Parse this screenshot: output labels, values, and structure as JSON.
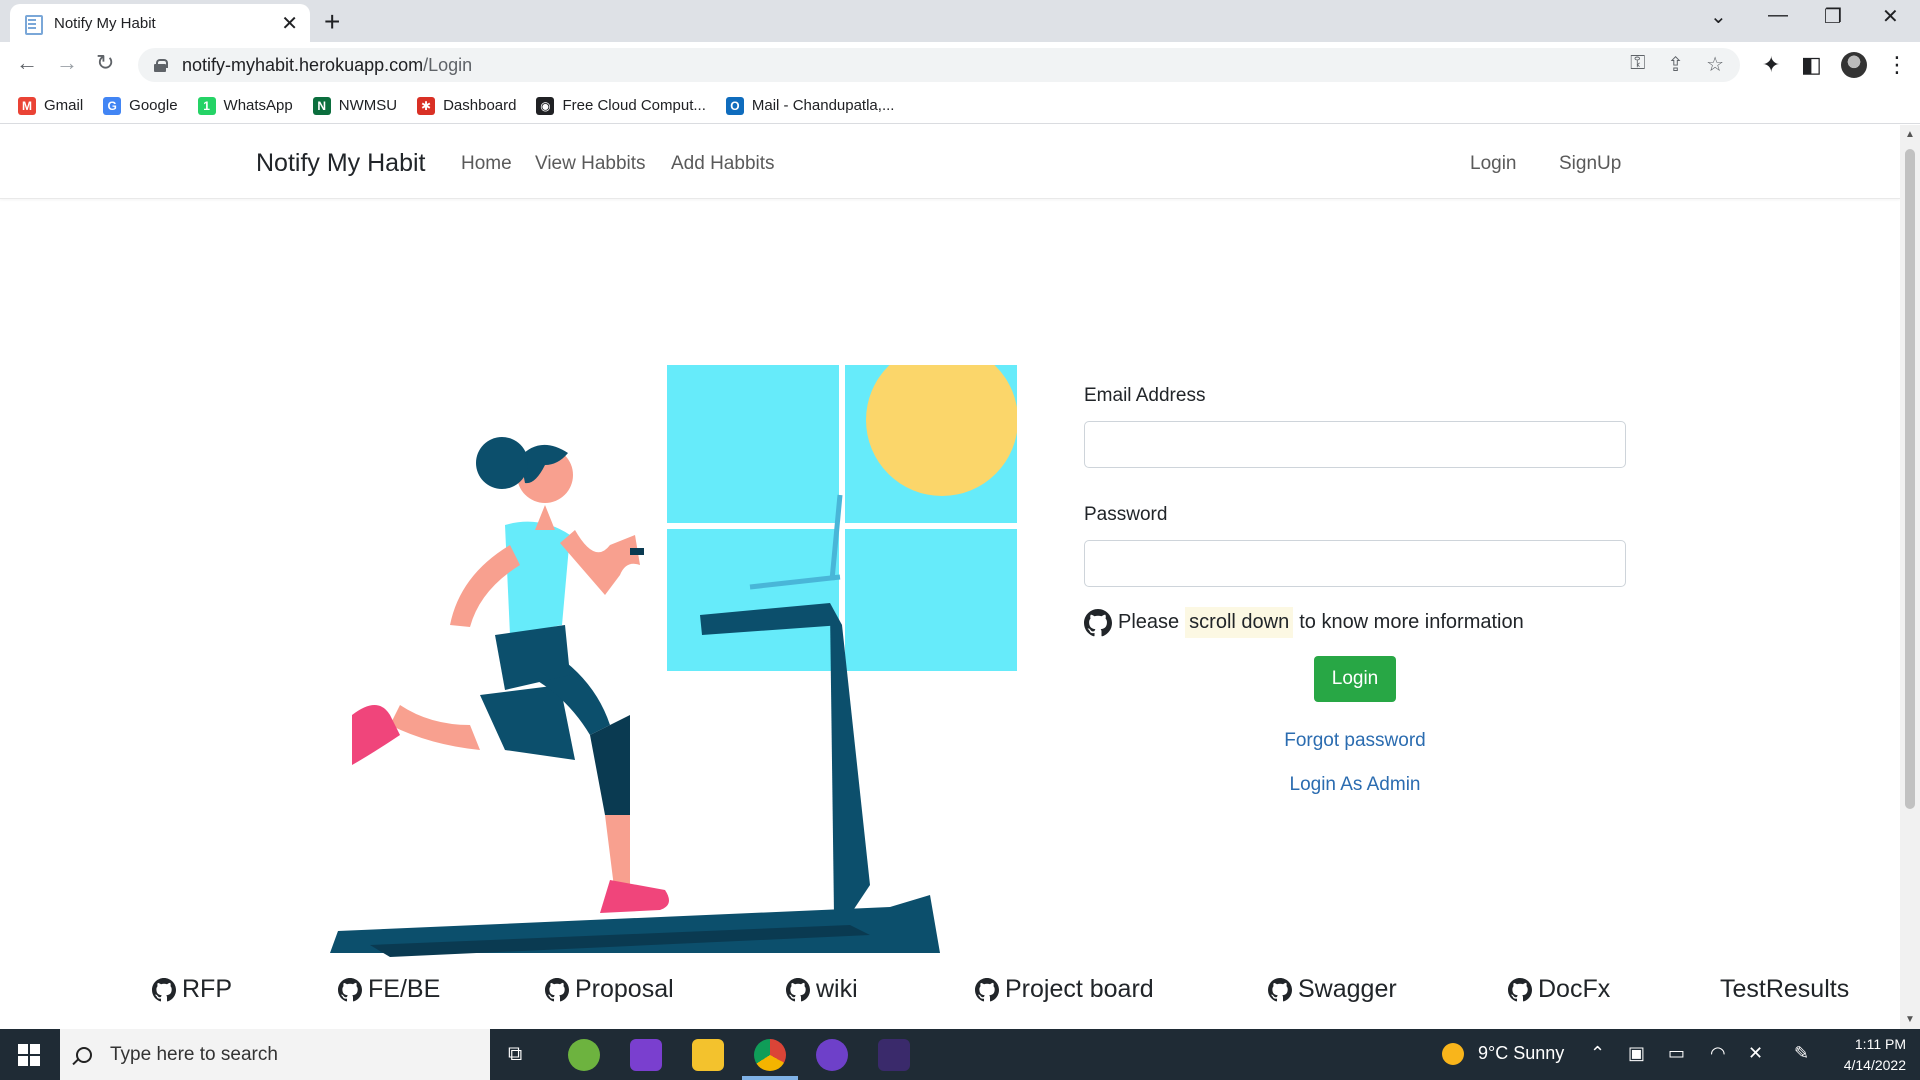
{
  "browser": {
    "tab_title": "Notify My Habit",
    "url_host": "notify-myhabit.herokuapp.com",
    "url_path": "/Login",
    "bookmarks": [
      {
        "label": "Gmail",
        "color": "#ea4335",
        "glyph": "M"
      },
      {
        "label": "Google",
        "color": "#4285f4",
        "glyph": "G"
      },
      {
        "label": "WhatsApp",
        "color": "#25d366",
        "glyph": "1"
      },
      {
        "label": "NWMSU",
        "color": "#0b6e3d",
        "glyph": "N"
      },
      {
        "label": "Dashboard",
        "color": "#d93025",
        "glyph": "✱"
      },
      {
        "label": "Free Cloud Comput...",
        "color": "#202124",
        "glyph": "◉"
      },
      {
        "label": "Mail - Chandupatla,...",
        "color": "#0f6cbd",
        "glyph": "O"
      }
    ]
  },
  "navbar": {
    "brand": "Notify My Habit",
    "links": [
      "Home",
      "View Habbits",
      "Add Habbits"
    ],
    "right_links": [
      "Login",
      "SignUp"
    ]
  },
  "form": {
    "email_label": "Email Address",
    "email_value": "",
    "password_label": "Password",
    "password_value": "",
    "info_before": "Please",
    "info_highlight": "scroll down",
    "info_after": "to know more information",
    "login_button": "Login",
    "forgot_password": "Forgot password",
    "admin_login": "Login As Admin",
    "button_color": "#28a745",
    "link_color": "#2b6cb0"
  },
  "footer_links": [
    "RFP",
    "FE/BE",
    "Proposal",
    "wiki",
    "Project board",
    "Swagger",
    "DocFx",
    "TestResults"
  ],
  "taskbar": {
    "search_placeholder": "Type here to search",
    "weather": "9°C  Sunny",
    "time": "1:11 PM",
    "date": "4/14/2022"
  }
}
